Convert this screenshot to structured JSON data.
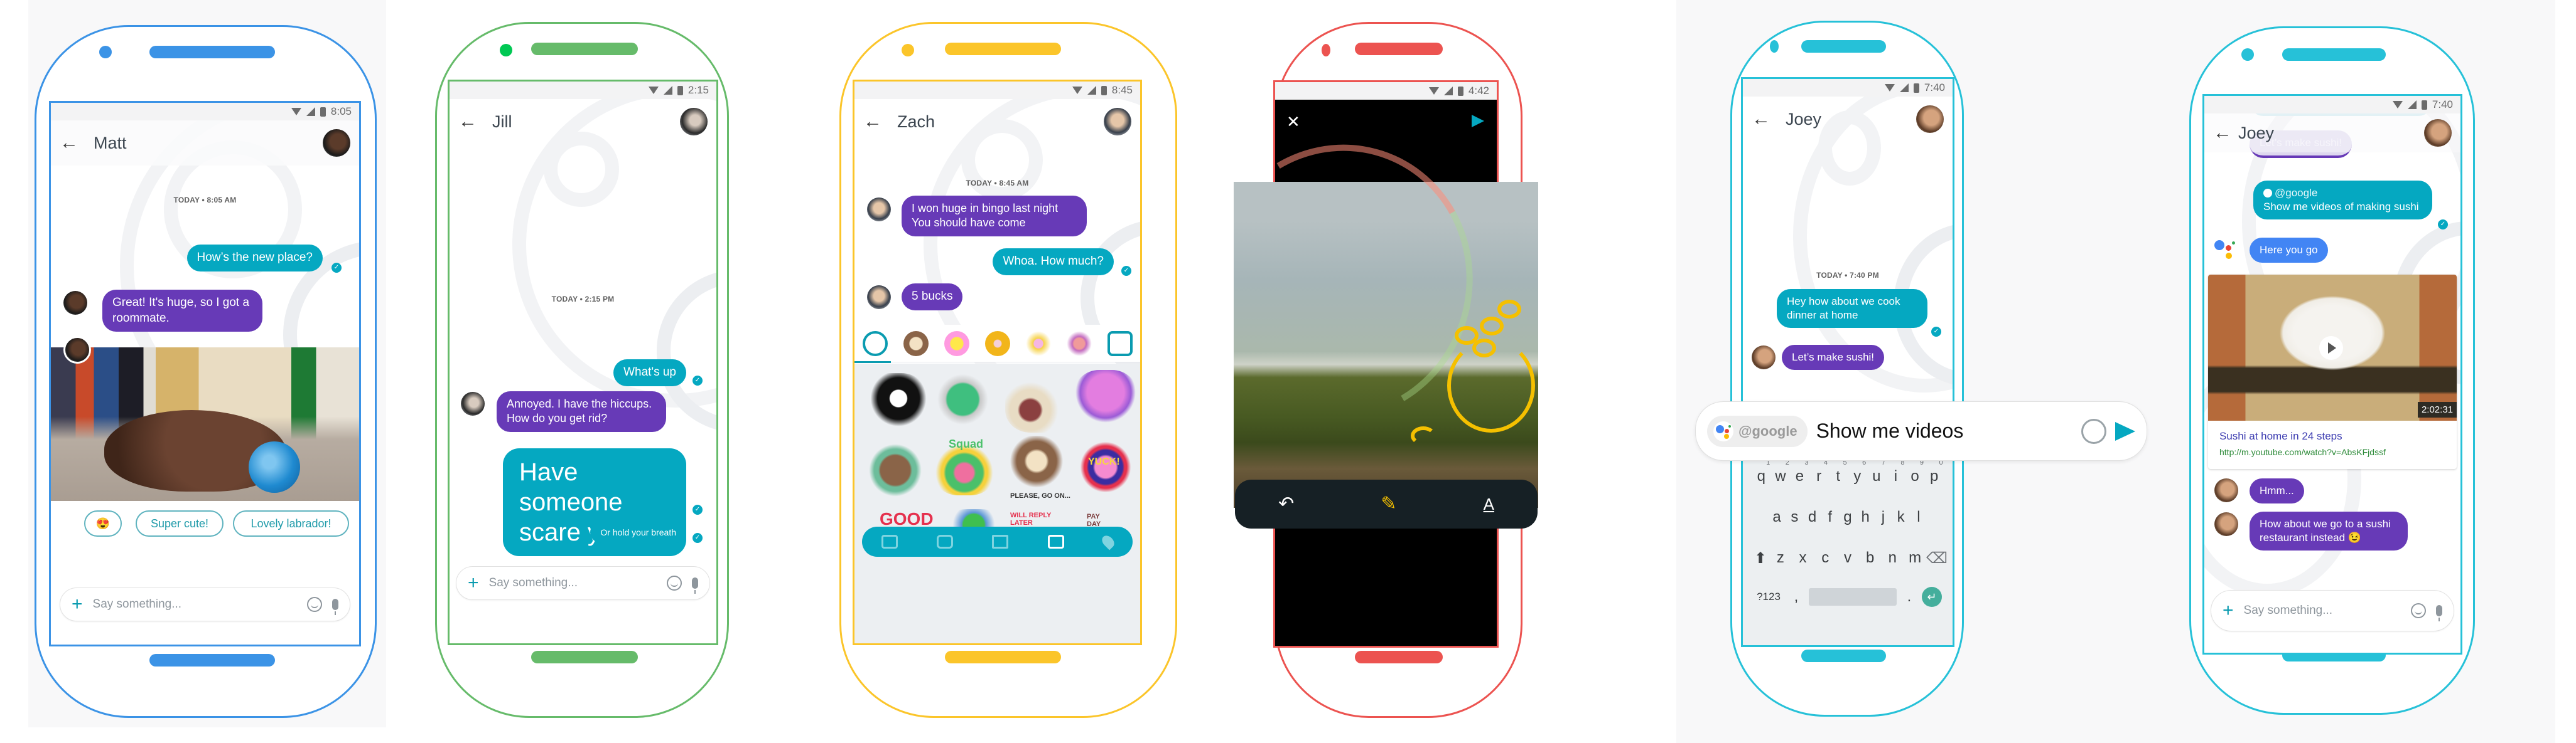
{
  "colors": {
    "phone_blue": "#3b93e6",
    "phone_green": "#66bb6a",
    "phone_yellow": "#fbc52a",
    "phone_red": "#ec5350",
    "phone_cyan": "#26c1d8",
    "bubble_outgoing": "#05a8c1",
    "bubble_incoming": "#673ab7",
    "bubble_assistant": "#4285f4"
  },
  "phones": [
    {
      "status_time": "8:05",
      "contact": "Matt",
      "timestamp": "TODAY • 8:05 AM",
      "messages": [
        {
          "dir": "out",
          "text": "How’s the new place?"
        },
        {
          "dir": "in",
          "text": "Great! It's huge, so I got a roommate."
        }
      ],
      "smart_replies": [
        "😍",
        "Super cute!",
        "Lovely labrador!"
      ],
      "composer_placeholder": "Say something..."
    },
    {
      "status_time": "2:15",
      "contact": "Jill",
      "timestamp": "TODAY • 2:15 PM",
      "messages": [
        {
          "dir": "out",
          "text": "What's up"
        },
        {
          "dir": "in",
          "text": "Annoyed. I have the hiccups. How do you get rid?"
        },
        {
          "dir": "out",
          "text": "Have someone scare you",
          "size": "large"
        },
        {
          "dir": "out",
          "text": "Or hold your breath",
          "size": "small"
        }
      ],
      "composer_placeholder": "Say something..."
    },
    {
      "status_time": "8:45",
      "contact": "Zach",
      "timestamp": "TODAY • 8:45 AM",
      "messages": [
        {
          "dir": "in",
          "text": "I won huge in bingo last night\nYou should have come"
        },
        {
          "dir": "out",
          "text": "Whoa. How much?"
        },
        {
          "dir": "in",
          "text": "5 bucks"
        }
      ],
      "sticker_tabs": [
        "recent-clock-icon",
        "sloth-sticker-pack",
        "flower-sticker-pack",
        "yak-sticker-pack",
        "fox-sticker-pack",
        "monkey-sticker-pack",
        "add-sticker-pack-icon"
      ],
      "sticker_labels": [
        "Squad",
        "YUCK!",
        "PLEASE, GO ON...",
        "GOOD",
        "WILL REPLY LATER",
        "PAY DAY"
      ],
      "attach_bar": [
        "keyboard-icon",
        "camera-icon",
        "gallery-icon",
        "sticker-icon",
        "location-icon"
      ],
      "active_attach": "sticker-icon"
    },
    {
      "status_time": "4:42",
      "editor_tools": [
        "undo-icon",
        "pen-icon",
        "text-icon"
      ],
      "close_label": "✕",
      "send_label": "send"
    },
    {
      "status_time": "7:40",
      "contact": "Joey",
      "timestamp": "TODAY • 7:40 PM",
      "messages": [
        {
          "dir": "out",
          "text": "Hey how about we cook dinner at home"
        },
        {
          "dir": "in",
          "text": "Let’s make sushi!"
        }
      ],
      "assistant_chip": "@google",
      "input_text": "Show me videos",
      "keyboard": {
        "row1": [
          "q",
          "w",
          "e",
          "r",
          "t",
          "y",
          "u",
          "i",
          "o",
          "p"
        ],
        "row1_hints": [
          "1",
          "2",
          "3",
          "4",
          "5",
          "6",
          "7",
          "8",
          "9",
          "0"
        ],
        "row2": [
          "a",
          "s",
          "d",
          "f",
          "g",
          "h",
          "j",
          "k",
          "l"
        ],
        "row3": [
          "z",
          "x",
          "c",
          "v",
          "b",
          "n",
          "m"
        ],
        "symbols_key": "?123",
        "comma": ",",
        "period": "."
      }
    },
    {
      "status_time": "7:40",
      "contact": "Joey",
      "messages": [
        {
          "dir": "in",
          "text": "Let’s make sushi!",
          "faded": true
        },
        {
          "dir": "out",
          "mention": "@google",
          "text": "Show me videos of making sushi"
        },
        {
          "dir": "assistant",
          "text": "Here you go"
        },
        {
          "dir": "in",
          "text": "Hmm..."
        },
        {
          "dir": "in",
          "text": "How about we go to a sushi restaurant instead 😉"
        }
      ],
      "video": {
        "title": "Sushi at home in 24 steps",
        "url": "http://m.youtube.com/watch?v=AbsKFjdssf",
        "duration": "2:02:31"
      },
      "composer_placeholder": "Say something..."
    }
  ]
}
